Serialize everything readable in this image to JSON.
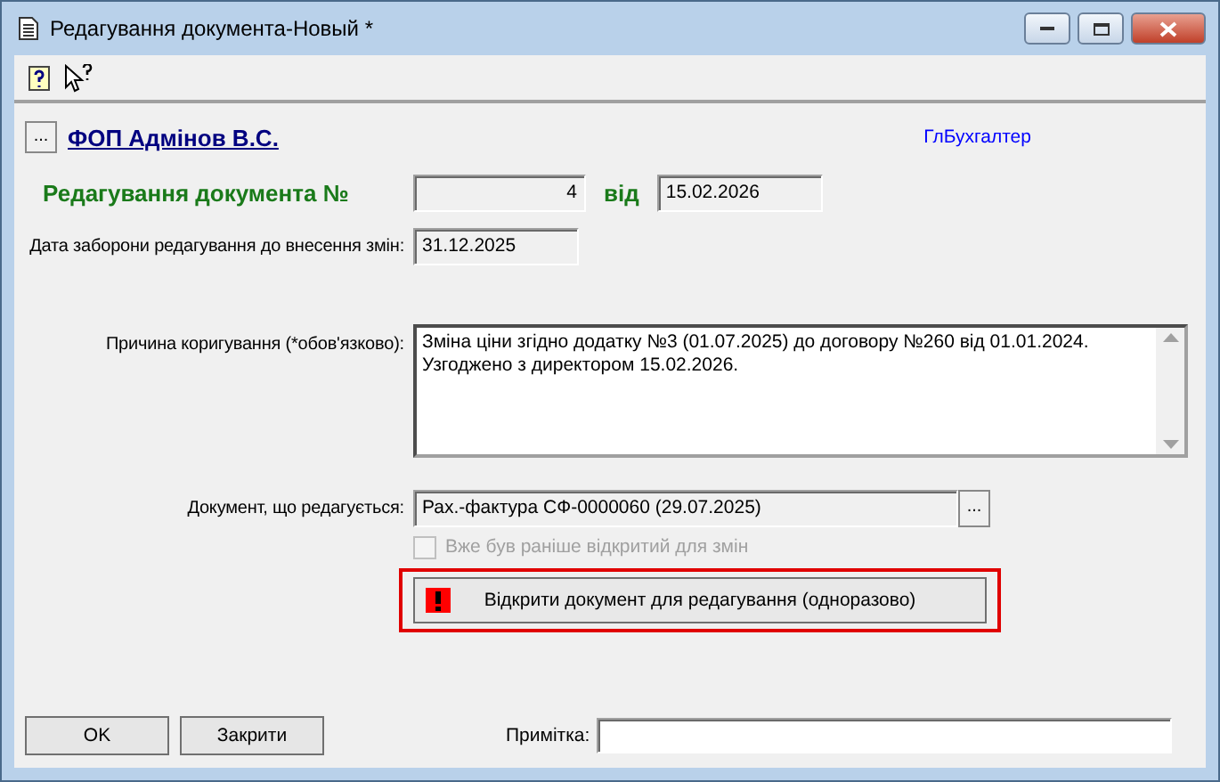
{
  "window": {
    "title": "Редагування документа-Новый *"
  },
  "header": {
    "organization": "ФОП Адмінов В.С.",
    "browse": "...",
    "role": "ГлБухгалтер"
  },
  "document_number": {
    "label": "Редагування документа №",
    "value": "4",
    "date_label": "від",
    "date": "15.02.2026"
  },
  "lock_date": {
    "label": "Дата заборони редагування до внесення змін:",
    "value": "31.12.2025"
  },
  "reason": {
    "label": "Причина коригування (*обов'язково):",
    "value": "Зміна ціни згідно додатку №3 (01.07.2025) до договору №260 від 01.01.2024.\nУзгоджено з директором 15.02.2026."
  },
  "edited_document": {
    "label": "Документ, що редагується:",
    "value": "Рах.-фактура СФ-0000060 (29.07.2025)",
    "browse": "..."
  },
  "opened_before": {
    "label": "Вже був раніше відкритий для змін",
    "checked": false,
    "disabled": true
  },
  "open_button": {
    "label": "Відкрити документ для редагування (одноразово)",
    "highlighted": true
  },
  "buttons": [
    "OK",
    "Закрити"
  ],
  "note": {
    "label": "Примітка:"
  }
}
